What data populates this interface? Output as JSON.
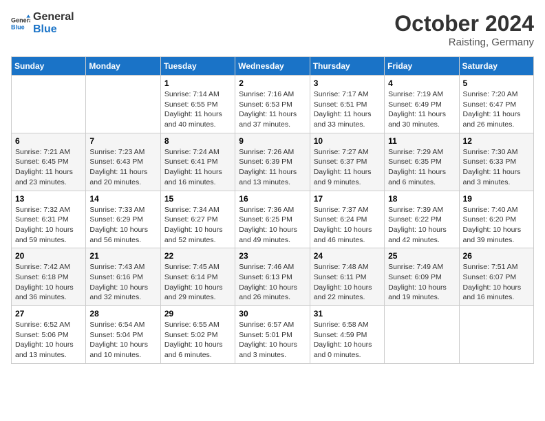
{
  "logo": {
    "line1": "General",
    "line2": "Blue"
  },
  "title": "October 2024",
  "subtitle": "Raisting, Germany",
  "days_header": [
    "Sunday",
    "Monday",
    "Tuesday",
    "Wednesday",
    "Thursday",
    "Friday",
    "Saturday"
  ],
  "weeks": [
    [
      {
        "day": "",
        "info": ""
      },
      {
        "day": "",
        "info": ""
      },
      {
        "day": "1",
        "info": "Sunrise: 7:14 AM\nSunset: 6:55 PM\nDaylight: 11 hours\nand 40 minutes."
      },
      {
        "day": "2",
        "info": "Sunrise: 7:16 AM\nSunset: 6:53 PM\nDaylight: 11 hours\nand 37 minutes."
      },
      {
        "day": "3",
        "info": "Sunrise: 7:17 AM\nSunset: 6:51 PM\nDaylight: 11 hours\nand 33 minutes."
      },
      {
        "day": "4",
        "info": "Sunrise: 7:19 AM\nSunset: 6:49 PM\nDaylight: 11 hours\nand 30 minutes."
      },
      {
        "day": "5",
        "info": "Sunrise: 7:20 AM\nSunset: 6:47 PM\nDaylight: 11 hours\nand 26 minutes."
      }
    ],
    [
      {
        "day": "6",
        "info": "Sunrise: 7:21 AM\nSunset: 6:45 PM\nDaylight: 11 hours\nand 23 minutes."
      },
      {
        "day": "7",
        "info": "Sunrise: 7:23 AM\nSunset: 6:43 PM\nDaylight: 11 hours\nand 20 minutes."
      },
      {
        "day": "8",
        "info": "Sunrise: 7:24 AM\nSunset: 6:41 PM\nDaylight: 11 hours\nand 16 minutes."
      },
      {
        "day": "9",
        "info": "Sunrise: 7:26 AM\nSunset: 6:39 PM\nDaylight: 11 hours\nand 13 minutes."
      },
      {
        "day": "10",
        "info": "Sunrise: 7:27 AM\nSunset: 6:37 PM\nDaylight: 11 hours\nand 9 minutes."
      },
      {
        "day": "11",
        "info": "Sunrise: 7:29 AM\nSunset: 6:35 PM\nDaylight: 11 hours\nand 6 minutes."
      },
      {
        "day": "12",
        "info": "Sunrise: 7:30 AM\nSunset: 6:33 PM\nDaylight: 11 hours\nand 3 minutes."
      }
    ],
    [
      {
        "day": "13",
        "info": "Sunrise: 7:32 AM\nSunset: 6:31 PM\nDaylight: 10 hours\nand 59 minutes."
      },
      {
        "day": "14",
        "info": "Sunrise: 7:33 AM\nSunset: 6:29 PM\nDaylight: 10 hours\nand 56 minutes."
      },
      {
        "day": "15",
        "info": "Sunrise: 7:34 AM\nSunset: 6:27 PM\nDaylight: 10 hours\nand 52 minutes."
      },
      {
        "day": "16",
        "info": "Sunrise: 7:36 AM\nSunset: 6:25 PM\nDaylight: 10 hours\nand 49 minutes."
      },
      {
        "day": "17",
        "info": "Sunrise: 7:37 AM\nSunset: 6:24 PM\nDaylight: 10 hours\nand 46 minutes."
      },
      {
        "day": "18",
        "info": "Sunrise: 7:39 AM\nSunset: 6:22 PM\nDaylight: 10 hours\nand 42 minutes."
      },
      {
        "day": "19",
        "info": "Sunrise: 7:40 AM\nSunset: 6:20 PM\nDaylight: 10 hours\nand 39 minutes."
      }
    ],
    [
      {
        "day": "20",
        "info": "Sunrise: 7:42 AM\nSunset: 6:18 PM\nDaylight: 10 hours\nand 36 minutes."
      },
      {
        "day": "21",
        "info": "Sunrise: 7:43 AM\nSunset: 6:16 PM\nDaylight: 10 hours\nand 32 minutes."
      },
      {
        "day": "22",
        "info": "Sunrise: 7:45 AM\nSunset: 6:14 PM\nDaylight: 10 hours\nand 29 minutes."
      },
      {
        "day": "23",
        "info": "Sunrise: 7:46 AM\nSunset: 6:13 PM\nDaylight: 10 hours\nand 26 minutes."
      },
      {
        "day": "24",
        "info": "Sunrise: 7:48 AM\nSunset: 6:11 PM\nDaylight: 10 hours\nand 22 minutes."
      },
      {
        "day": "25",
        "info": "Sunrise: 7:49 AM\nSunset: 6:09 PM\nDaylight: 10 hours\nand 19 minutes."
      },
      {
        "day": "26",
        "info": "Sunrise: 7:51 AM\nSunset: 6:07 PM\nDaylight: 10 hours\nand 16 minutes."
      }
    ],
    [
      {
        "day": "27",
        "info": "Sunrise: 6:52 AM\nSunset: 5:06 PM\nDaylight: 10 hours\nand 13 minutes."
      },
      {
        "day": "28",
        "info": "Sunrise: 6:54 AM\nSunset: 5:04 PM\nDaylight: 10 hours\nand 10 minutes."
      },
      {
        "day": "29",
        "info": "Sunrise: 6:55 AM\nSunset: 5:02 PM\nDaylight: 10 hours\nand 6 minutes."
      },
      {
        "day": "30",
        "info": "Sunrise: 6:57 AM\nSunset: 5:01 PM\nDaylight: 10 hours\nand 3 minutes."
      },
      {
        "day": "31",
        "info": "Sunrise: 6:58 AM\nSunset: 4:59 PM\nDaylight: 10 hours\nand 0 minutes."
      },
      {
        "day": "",
        "info": ""
      },
      {
        "day": "",
        "info": ""
      }
    ]
  ]
}
